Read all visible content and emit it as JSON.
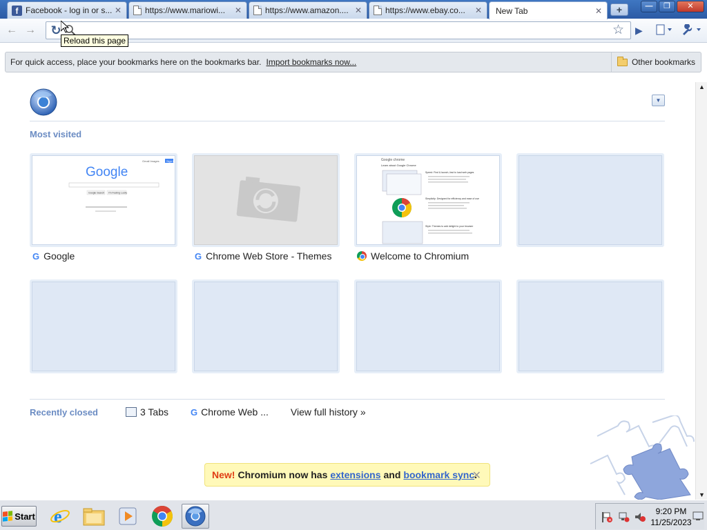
{
  "tabs": [
    {
      "title": "Facebook - log in or s...",
      "icon": "facebook-icon"
    },
    {
      "title": "https://www.mariowi...",
      "icon": "page-icon"
    },
    {
      "title": "https://www.amazon....",
      "icon": "page-icon"
    },
    {
      "title": "https://www.ebay.co...",
      "icon": "page-icon"
    },
    {
      "title": "New Tab",
      "icon": "none"
    }
  ],
  "toolbar": {
    "tooltip": "Reload this page",
    "omnibox_value": ""
  },
  "bookmarks_bar": {
    "message": "For quick access, place your bookmarks here on the bookmarks bar.",
    "import_link": "Import bookmarks now...",
    "other_bookmarks": "Other bookmarks"
  },
  "most_visited": {
    "title": "Most visited",
    "tiles": [
      {
        "label": "Google",
        "favicon": "google-g-icon",
        "thumbnail": "google-homepage"
      },
      {
        "label": "Chrome Web Store - Themes",
        "favicon": "google-g-icon",
        "thumbnail": "camera-placeholder"
      },
      {
        "label": "Welcome to Chromium",
        "favicon": "chrome-icon",
        "thumbnail": "chrome-welcome-page"
      },
      {
        "label": "",
        "thumbnail": "empty"
      },
      {
        "label": "",
        "thumbnail": "empty"
      },
      {
        "label": "",
        "thumbnail": "empty"
      },
      {
        "label": "",
        "thumbnail": "empty"
      },
      {
        "label": "",
        "thumbnail": "empty"
      }
    ],
    "thumb_text": {
      "google_logo": "Google",
      "google_btn1": "Google Search",
      "google_btn2": "I'm Feeling Lucky",
      "google_top": "Gmail Images",
      "google_signin": "Sign in",
      "chrome_logo": "Google chrome",
      "chrome_heading": "Learn about Google Chrome",
      "chrome_s1": "Speed: Find & launch, fast to load web pages",
      "chrome_s2": "Simplicity: Designed for efficiency and ease of use",
      "chrome_s3": "Style: Themes to add delight to your browser"
    }
  },
  "recently_closed": {
    "title": "Recently closed",
    "items": [
      {
        "label": "3 Tabs",
        "icon": "tabs-icon"
      },
      {
        "label": "Chrome Web ...",
        "icon": "google-g-icon"
      }
    ],
    "history_link": "View full history",
    "history_arrow": "»"
  },
  "promo": {
    "new_label": "New!",
    "text1": "Chromium now has",
    "link1": "extensions",
    "text2": "and",
    "link2": "bookmark sync",
    "text3": "."
  },
  "taskbar": {
    "start_label": "Start",
    "apps": [
      "internet-explorer-icon",
      "file-explorer-icon",
      "media-player-icon",
      "chrome-icon",
      "chromium-icon"
    ],
    "time": "9:20 PM",
    "date": "11/25/2023"
  },
  "colors": {
    "accent": "#6b8cc3",
    "link": "#3366cc",
    "promo_bg": "#fff9b9",
    "new_red": "#e03d14"
  }
}
